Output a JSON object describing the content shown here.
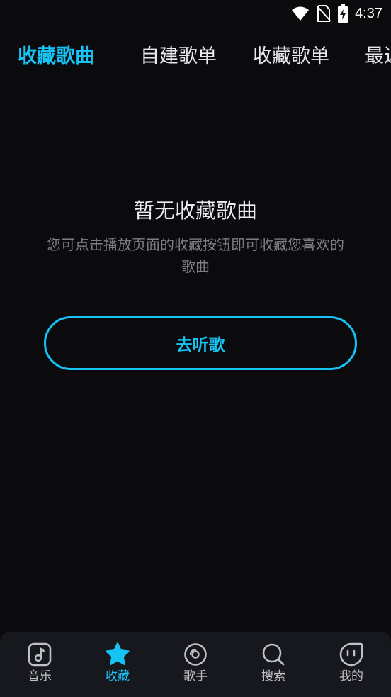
{
  "status": {
    "time": "4:37",
    "icons": [
      "wifi-icon",
      "no-sim-icon",
      "battery-charging-icon"
    ]
  },
  "tabs": [
    {
      "label": "收藏歌曲",
      "active": true
    },
    {
      "label": "自建歌单",
      "active": false
    },
    {
      "label": "收藏歌单",
      "active": false
    },
    {
      "label": "最近",
      "active": false
    }
  ],
  "empty": {
    "title": "暂无收藏歌曲",
    "description": "您可点击播放页面的收藏按钮即可收藏您喜欢的歌曲",
    "button_label": "去听歌"
  },
  "bottom_nav": [
    {
      "label": "音乐",
      "icon": "music-note-icon",
      "active": false
    },
    {
      "label": "收藏",
      "icon": "star-icon",
      "active": true
    },
    {
      "label": "歌手",
      "icon": "disc-icon",
      "active": false
    },
    {
      "label": "搜索",
      "icon": "search-icon",
      "active": false
    },
    {
      "label": "我的",
      "icon": "profile-face-icon",
      "active": false
    }
  ],
  "colors": {
    "accent": "#16c3f4",
    "background": "#0b0b0e",
    "nav_background": "#17181d",
    "muted_text": "#7d7e86"
  }
}
